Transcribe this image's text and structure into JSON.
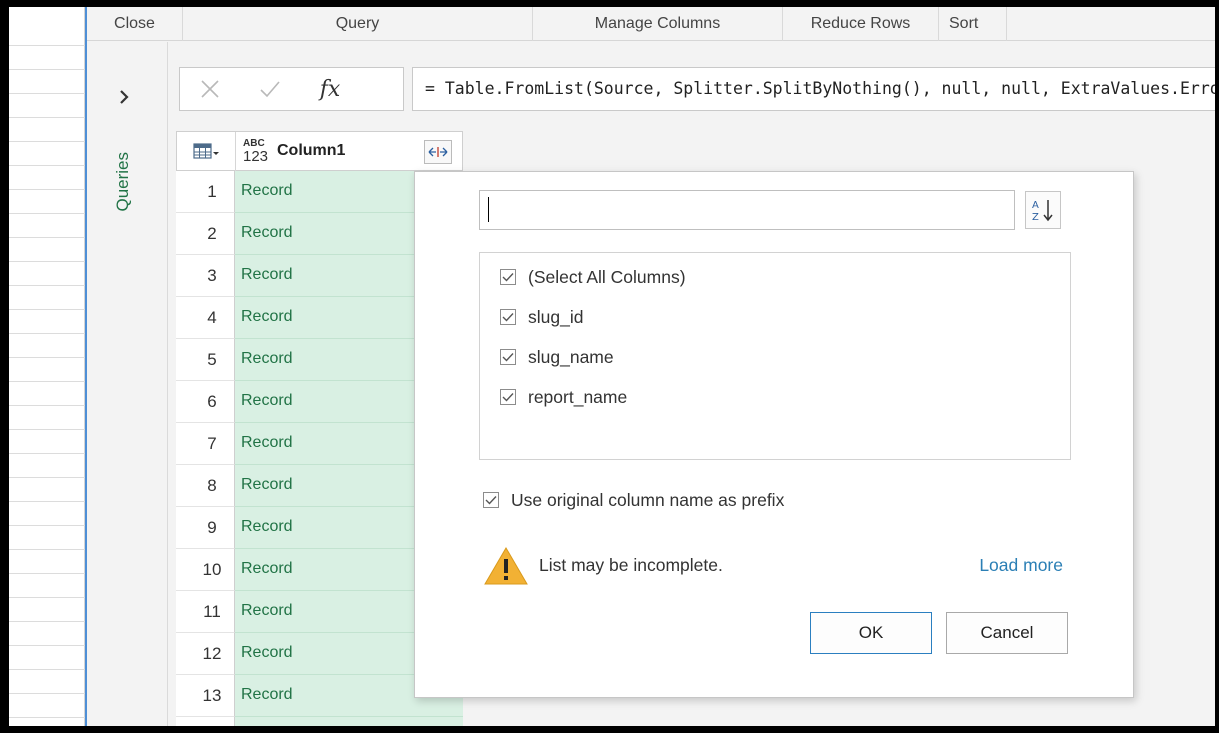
{
  "ribbon": {
    "groups": [
      "Close",
      "Query",
      "Manage Columns",
      "Reduce Rows",
      "Sort"
    ]
  },
  "queries_pane": {
    "label": "Queries",
    "expand_icon": "chevron-right-icon"
  },
  "formula_bar": {
    "cancel_icon": "close-icon",
    "commit_icon": "check-icon",
    "fx_label": "fx",
    "formula": "= Table.FromList(Source, Splitter.SplitByNothing(), null, null, ExtraValues.Error)"
  },
  "table": {
    "type_badge_top": "ABC",
    "type_badge_bottom": "123",
    "column_name": "Column1",
    "rows": [
      {
        "num": "1",
        "value": "Record"
      },
      {
        "num": "2",
        "value": "Record"
      },
      {
        "num": "3",
        "value": "Record"
      },
      {
        "num": "4",
        "value": "Record"
      },
      {
        "num": "5",
        "value": "Record"
      },
      {
        "num": "6",
        "value": "Record"
      },
      {
        "num": "7",
        "value": "Record"
      },
      {
        "num": "8",
        "value": "Record"
      },
      {
        "num": "9",
        "value": "Record"
      },
      {
        "num": "10",
        "value": "Record"
      },
      {
        "num": "11",
        "value": "Record"
      },
      {
        "num": "12",
        "value": "Record"
      },
      {
        "num": "13",
        "value": "Record"
      }
    ]
  },
  "expand_panel": {
    "search_value": "",
    "columns": [
      {
        "label": "(Select All Columns)",
        "checked": true
      },
      {
        "label": "slug_id",
        "checked": true
      },
      {
        "label": "slug_name",
        "checked": true
      },
      {
        "label": "report_name",
        "checked": true
      }
    ],
    "prefix_label": "Use original column name as prefix",
    "prefix_checked": true,
    "warning_text": "List may be incomplete.",
    "load_more": "Load more",
    "ok_label": "OK",
    "cancel_label": "Cancel"
  },
  "colors": {
    "accent_green": "#217346",
    "cell_green": "#d9f0e3",
    "link_blue": "#2b7fb5",
    "ok_border": "#2b7fc0",
    "warning": "#f2b134"
  }
}
